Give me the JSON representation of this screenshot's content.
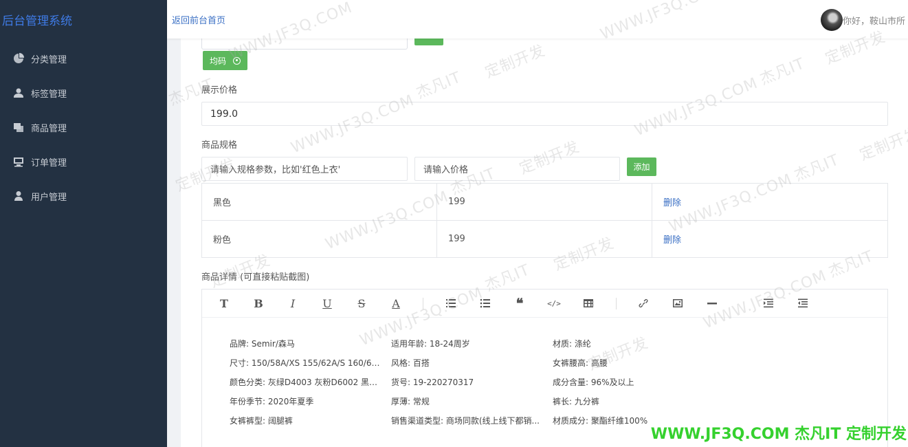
{
  "app": {
    "title": "后台管理系统"
  },
  "header": {
    "back_link": "返回前台首页",
    "greeting": "你好，鞍山市所"
  },
  "sidebar": {
    "items": [
      {
        "label": "分类管理",
        "icon": "category-icon"
      },
      {
        "label": "标签管理",
        "icon": "tag-user-icon"
      },
      {
        "label": "商品管理",
        "icon": "goods-icon"
      },
      {
        "label": "订单管理",
        "icon": "order-icon"
      },
      {
        "label": "用户管理",
        "icon": "user-icon"
      }
    ]
  },
  "form": {
    "size_tag": "均码",
    "display_price_label": "展示价格",
    "display_price_value": "199.0",
    "spec_label": "商品规格",
    "spec_param_placeholder": "请输入规格参数，比如'红色上衣'",
    "spec_price_placeholder": "请输入价格",
    "add_button": "添加",
    "spec_rows": [
      {
        "name": "黑色",
        "price": "199",
        "action": "删除"
      },
      {
        "name": "粉色",
        "price": "199",
        "action": "删除"
      }
    ],
    "detail_label": "商品详情 (可直接粘贴截图)"
  },
  "editor": {
    "toolbar": [
      "title",
      "bold",
      "italic",
      "underline",
      "strikethrough",
      "font-color",
      "ordered-list",
      "unordered-list",
      "quote",
      "code",
      "table",
      "link",
      "image",
      "horizontal-rule",
      "indent",
      "outdent"
    ],
    "details": [
      [
        "品牌: Semir/森马",
        "适用年龄: 18-24周岁",
        "材质: 涤纶"
      ],
      [
        "尺寸: 150/58A/XS 155/62A/S 160/66A/...",
        "风格: 百搭",
        "女裤腰高: 高腰"
      ],
      [
        "颜色分类: 灰绿D4003 灰粉D6002 黑色...",
        "货号: 19-220270317",
        "成分含量: 96%及以上"
      ],
      [
        "年份季节: 2020年夏季",
        "厚薄: 常规",
        "裤长: 九分裤"
      ],
      [
        "女裤裤型: 阔腿裤",
        "销售渠道类型: 商场同款(线上线下都销...",
        "材质成分: 聚酯纤维100%"
      ]
    ]
  },
  "watermark": {
    "domain_text": "WWW.JF3Q.COM",
    "brand_text": "杰凡IT",
    "slogan_text": "定制开发",
    "footer_text": "WWW.JF3Q.COM 杰凡IT  定制开发"
  },
  "colors": {
    "sidebar_bg": "#233142",
    "brand": "#3f7be6",
    "link": "#3a6fc4",
    "success": "#5cb85c",
    "watermark_green": "#35d12e"
  }
}
